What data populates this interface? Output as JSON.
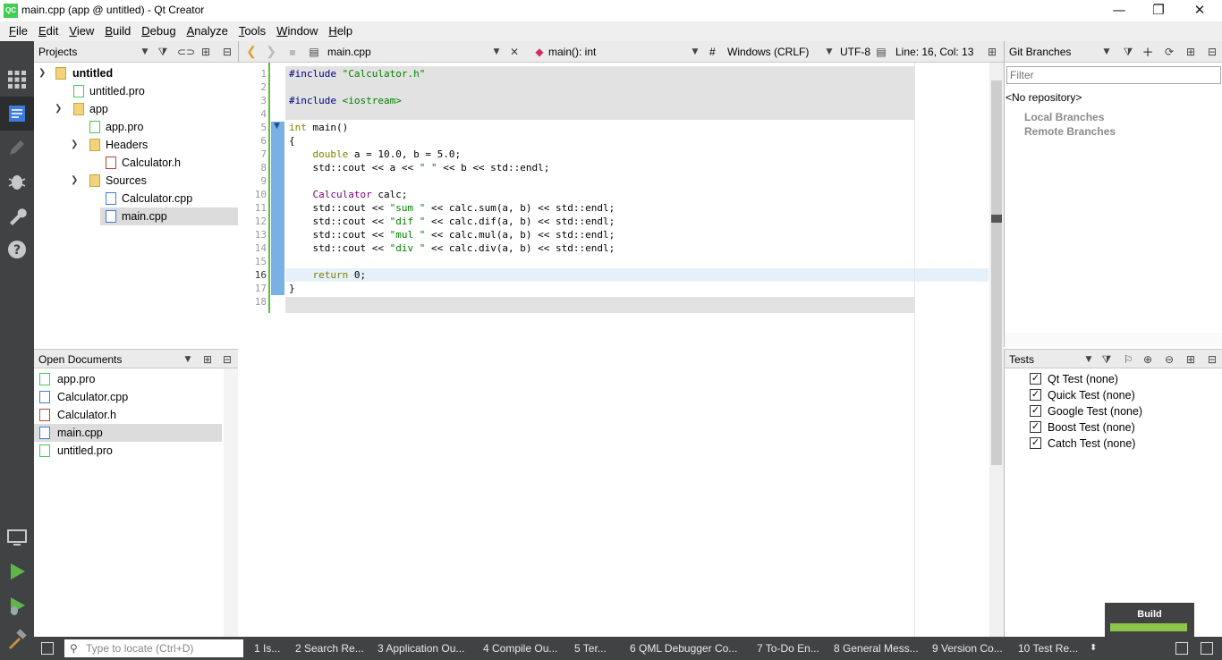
{
  "window": {
    "title": "main.cpp (app @ untitled) - Qt Creator",
    "icon_text": "QC",
    "minimize": "—",
    "maximize": "❐",
    "close": "✕"
  },
  "menu": [
    "File",
    "Edit",
    "View",
    "Build",
    "Debug",
    "Analyze",
    "Tools",
    "Window",
    "Help"
  ],
  "projects": {
    "header": "Projects",
    "tree": [
      {
        "label": "untitled",
        "bold": true
      },
      {
        "label": "untitled.pro"
      },
      {
        "label": "app"
      },
      {
        "label": "app.pro"
      },
      {
        "label": "Headers"
      },
      {
        "label": "Calculator.h"
      },
      {
        "label": "Sources"
      },
      {
        "label": "Calculator.cpp"
      },
      {
        "label": "main.cpp",
        "selected": true
      }
    ]
  },
  "open_documents": {
    "header": "Open Documents",
    "items": [
      "app.pro",
      "Calculator.cpp",
      "Calculator.h",
      "main.cpp",
      "untitled.pro"
    ],
    "selected": "main.cpp"
  },
  "editor": {
    "file": "main.cpp",
    "symbol": "main(): int",
    "hash": "#",
    "line_ending": "Windows (CRLF)",
    "encoding": "UTF-8",
    "position": "Line: 16, Col: 13",
    "current_line": 16,
    "lines": [
      "#include \"Calculator.h\"",
      "",
      "#include <iostream>",
      "",
      "int main()",
      "{",
      "    double a = 10.0, b = 5.0;",
      "    std::cout << a << \" \" << b << std::endl;",
      "",
      "    Calculator calc;",
      "    std::cout << \"sum \" << calc.sum(a, b) << std::endl;",
      "    std::cout << \"dif \" << calc.dif(a, b) << std::endl;",
      "    std::cout << \"mul \" << calc.mul(a, b) << std::endl;",
      "    std::cout << \"div \" << calc.div(a, b) << std::endl;",
      "",
      "    return 0;",
      "}",
      ""
    ],
    "line_numbers": [
      "1",
      "2",
      "3",
      "4",
      "5",
      "6",
      "7",
      "8",
      "9",
      "10",
      "11",
      "12",
      "13",
      "14",
      "15",
      "16",
      "17",
      "18"
    ]
  },
  "git": {
    "header": "Git Branches",
    "filter_placeholder": "Filter",
    "repo": "<No repository>",
    "local": "Local Branches",
    "remote": "Remote Branches"
  },
  "tests": {
    "header": "Tests",
    "items": [
      "Qt Test (none)",
      "Quick Test (none)",
      "Google Test (none)",
      "Boost Test (none)",
      "Catch Test (none)"
    ]
  },
  "status": {
    "locator_placeholder": "Type to locate (Ctrl+D)",
    "tabs": [
      "1  Is...",
      "2  Search Re...",
      "3  Application Ou...",
      "4  Compile Ou...",
      "5  Ter...",
      "6  QML Debugger Co...",
      "7  To-Do En...",
      "8  General Mess...",
      "9  Version Co...",
      "10  Test Re..."
    ]
  },
  "build_widget": {
    "label": "Build",
    "progress": 1.0
  },
  "colors": {
    "modebar": "#404244",
    "build_progress": "#8ec64c",
    "keyword": "#808000",
    "string": "#008000"
  }
}
